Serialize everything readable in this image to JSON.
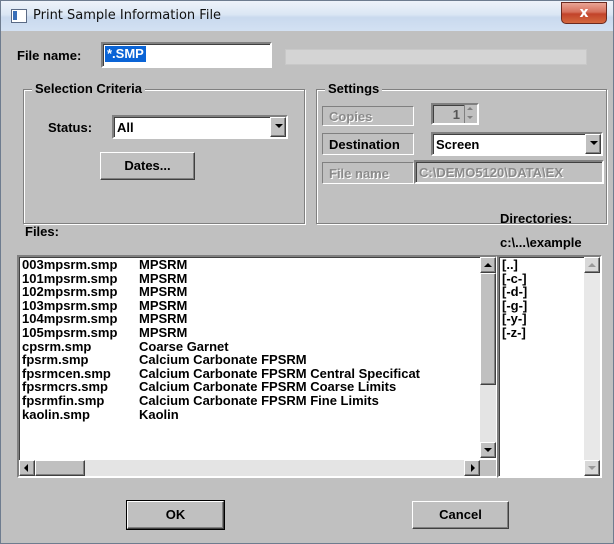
{
  "window": {
    "title": "Print Sample Information File",
    "close_label": "x"
  },
  "file_name": {
    "label": "File name:",
    "value": "*.SMP"
  },
  "selection_criteria": {
    "title": "Selection Criteria",
    "status_label": "Status:",
    "status_value": "All",
    "dates_button": "Dates..."
  },
  "settings": {
    "title": "Settings",
    "copies_label": "Copies",
    "copies_value": "1",
    "destination_label": "Destination",
    "destination_value": "Screen",
    "file_name_label": "File name",
    "file_name_value": "C:\\DEMO5120\\DATA\\EX"
  },
  "files": {
    "label": "Files:",
    "rows": [
      {
        "name": "003mpsrm.smp",
        "desc": "MPSRM"
      },
      {
        "name": "101mpsrm.smp",
        "desc": "MPSRM"
      },
      {
        "name": "102mpsrm.smp",
        "desc": "MPSRM"
      },
      {
        "name": "103mpsrm.smp",
        "desc": "MPSRM"
      },
      {
        "name": "104mpsrm.smp",
        "desc": "MPSRM"
      },
      {
        "name": "105mpsrm.smp",
        "desc": "MPSRM"
      },
      {
        "name": "cpsrm.smp",
        "desc": "Coarse Garnet"
      },
      {
        "name": "fpsrm.smp",
        "desc": "Calcium Carbonate FPSRM"
      },
      {
        "name": "fpsrmcen.smp",
        "desc": "Calcium Carbonate FPSRM Central Specificat"
      },
      {
        "name": "fpsrmcrs.smp",
        "desc": "Calcium Carbonate FPSRM Coarse Limits"
      },
      {
        "name": "fpsrmfin.smp",
        "desc": "Calcium Carbonate FPSRM Fine Limits"
      },
      {
        "name": "kaolin.smp",
        "desc": "Kaolin"
      }
    ]
  },
  "directories": {
    "label": "Directories:",
    "path": "c:\\...\\example",
    "items": [
      "[..]",
      "[-c-]",
      "[-d-]",
      "[-g-]",
      "[-y-]",
      "[-z-]"
    ]
  },
  "buttons": {
    "ok": "OK",
    "cancel": "Cancel"
  },
  "colors": {
    "selection": "#0a64d6",
    "close_button": "#c2432a"
  }
}
